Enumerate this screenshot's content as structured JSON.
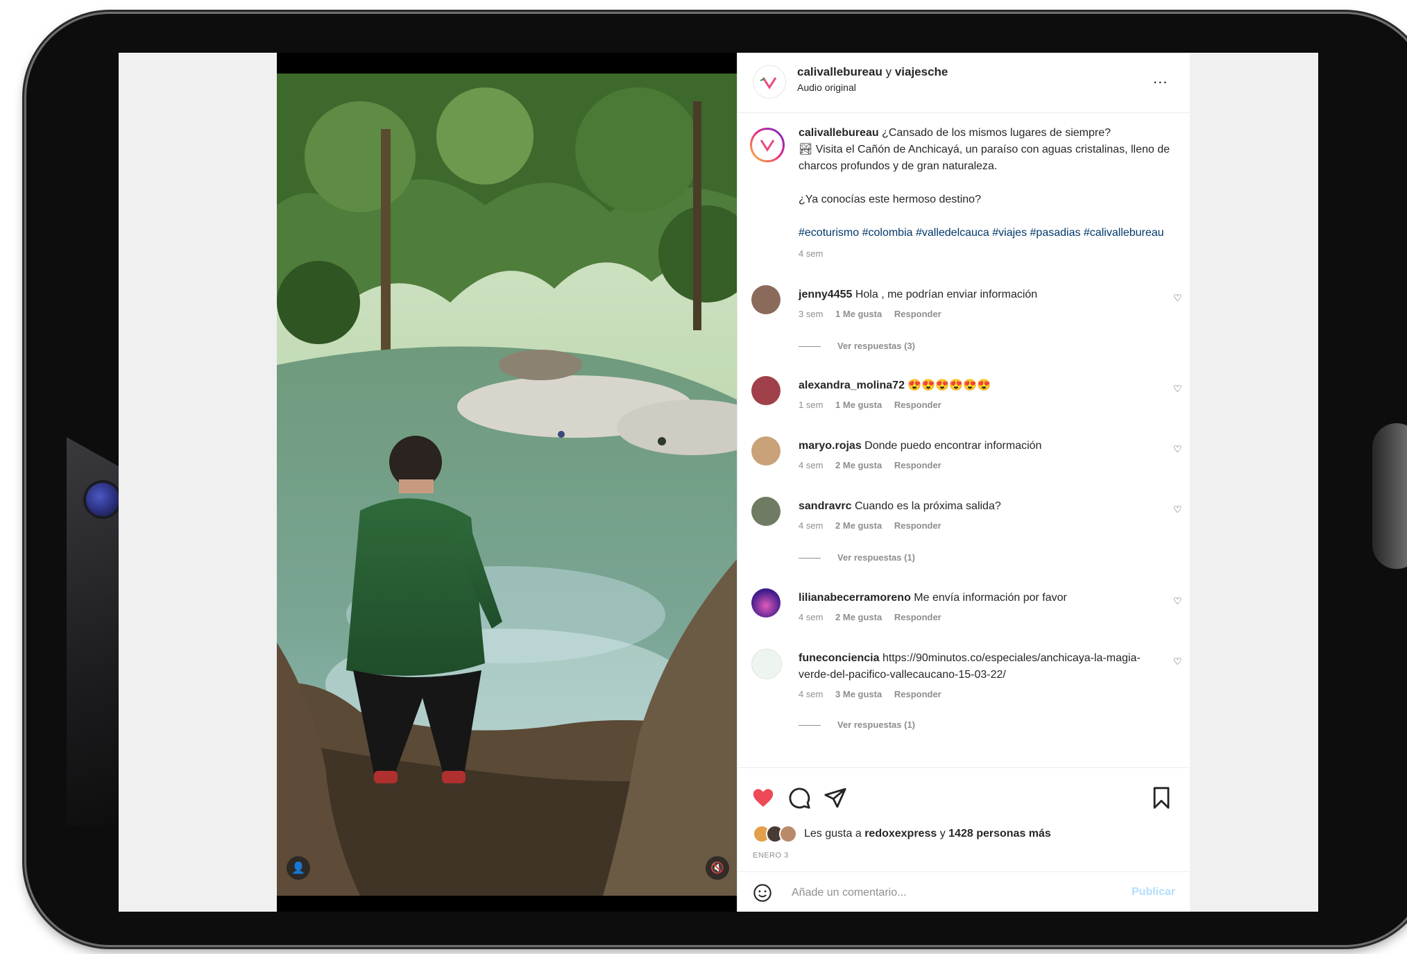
{
  "post": {
    "header": {
      "author_1": "calivallebureau",
      "joiner": "y",
      "author_2": "viajesche",
      "audio": "Audio original",
      "more_label": "..."
    },
    "caption": {
      "username": "calivallebureau",
      "line1": "¿Cansado de los mismos lugares de siempre?",
      "line2": "Visita el Cañón de Anchicayá, un paraíso con aguas cristalinas, lleno de charcos profundos y de gran naturaleza.",
      "question": "¿Ya conocías este hermoso destino?",
      "hashtags": "#ecoturismo #colombia #valledelcauca #viajes #pasadias #calivallebureau",
      "time": "4 sem"
    },
    "comments": [
      {
        "username": "jenny4455",
        "text": "Hola , me podrían enviar información",
        "time": "3 sem",
        "likes": "1 Me gusta",
        "reply": "Responder",
        "view_replies": "Ver respuestas (3)",
        "avatar_color": "#8a6a5a"
      },
      {
        "username": "alexandra_molina72",
        "text": "😍😍😍😍😍😍",
        "time": "1 sem",
        "likes": "1 Me gusta",
        "reply": "Responder",
        "view_replies": "",
        "avatar_color": "#a0404a"
      },
      {
        "username": "maryo.rojas",
        "text": "Donde puedo encontrar información",
        "time": "4 sem",
        "likes": "2 Me gusta",
        "reply": "Responder",
        "view_replies": "",
        "avatar_color": "#c9a27a"
      },
      {
        "username": "sandravrc",
        "text": "Cuando es la próxima salida?",
        "time": "4 sem",
        "likes": "2 Me gusta",
        "reply": "Responder",
        "view_replies": "Ver respuestas (1)",
        "avatar_color": "#6f7b62"
      },
      {
        "username": "lilianabecerramoreno",
        "text": "Me envía información por favor",
        "time": "4 sem",
        "likes": "2 Me gusta",
        "reply": "Responder",
        "view_replies": "",
        "avatar_color": "#4a2aa8"
      },
      {
        "username": "funeconciencia",
        "text": "https://90minutos.co/especiales/anchicaya-la-magia-verde-del-pacifico-vallecaucano-15-03-22/",
        "time": "4 sem",
        "likes": "3 Me gusta",
        "reply": "Responder",
        "view_replies": "Ver respuestas (1)",
        "avatar_color": "#eef5ee"
      }
    ],
    "likes": {
      "prefix": "Les gusta a",
      "first_user": "redoxexpress",
      "joiner": "y",
      "others": "1428 personas más"
    },
    "date": "ENERO 3",
    "add_comment": {
      "placeholder": "Añade un comentario...",
      "publish": "Publicar"
    },
    "colors": {
      "like_red": "#ed4956",
      "hashtag_blue": "#00376b",
      "publish_disabled": "#b2dffc",
      "muted_text": "#8e8e8e"
    },
    "icons": [
      "heart-icon",
      "comment-icon",
      "share-icon",
      "bookmark-icon",
      "emoji-icon",
      "user-tag-icon",
      "mute-icon"
    ]
  }
}
